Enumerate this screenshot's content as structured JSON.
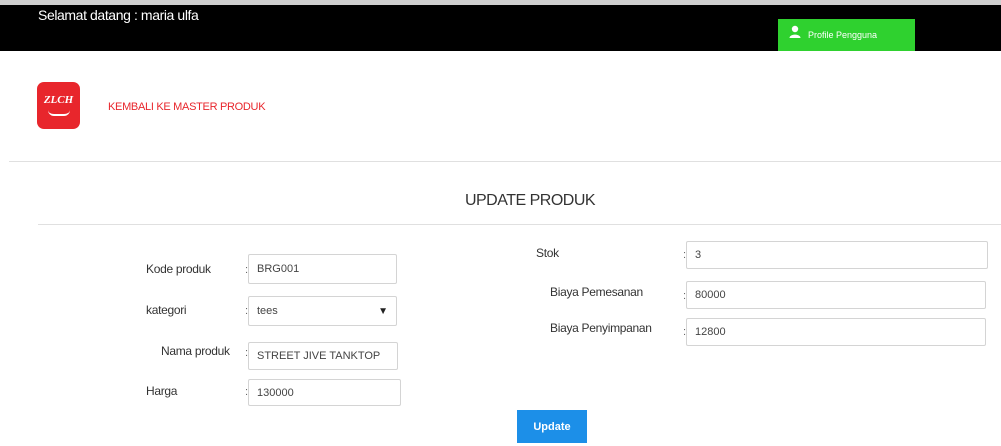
{
  "header": {
    "welcome": "Selamat datang : maria ulfa",
    "profile_label": "Profile Pengguna"
  },
  "brand": {
    "logo_text": "ZLCH",
    "back_link": "KEMBALI KE MASTER PRODUK"
  },
  "form": {
    "title": "UPDATE PRODUK",
    "colon": ":",
    "kode_produk": {
      "label": "Kode produk",
      "value": "BRG001"
    },
    "kategori": {
      "label": "kategori",
      "value": "tees"
    },
    "nama_produk": {
      "label": "Nama produk",
      "value": "STREET JIVE TANKTOP"
    },
    "harga": {
      "label": "Harga",
      "value": "130000"
    },
    "stok": {
      "label": "Stok",
      "value": "3"
    },
    "biaya_pemesanan": {
      "label": "Biaya Pemesanan",
      "value": "80000"
    },
    "biaya_penyimpanan": {
      "label": "Biaya Penyimpanan",
      "value": "12800"
    },
    "update_label": "Update"
  },
  "colors": {
    "header_bg": "#000000",
    "profile_bg": "#2fd12f",
    "accent_red": "#e8262c",
    "button_blue": "#1c8fe8"
  },
  "icons": {
    "profile": "user-avatar-icon",
    "select": "caret-down-icon"
  }
}
